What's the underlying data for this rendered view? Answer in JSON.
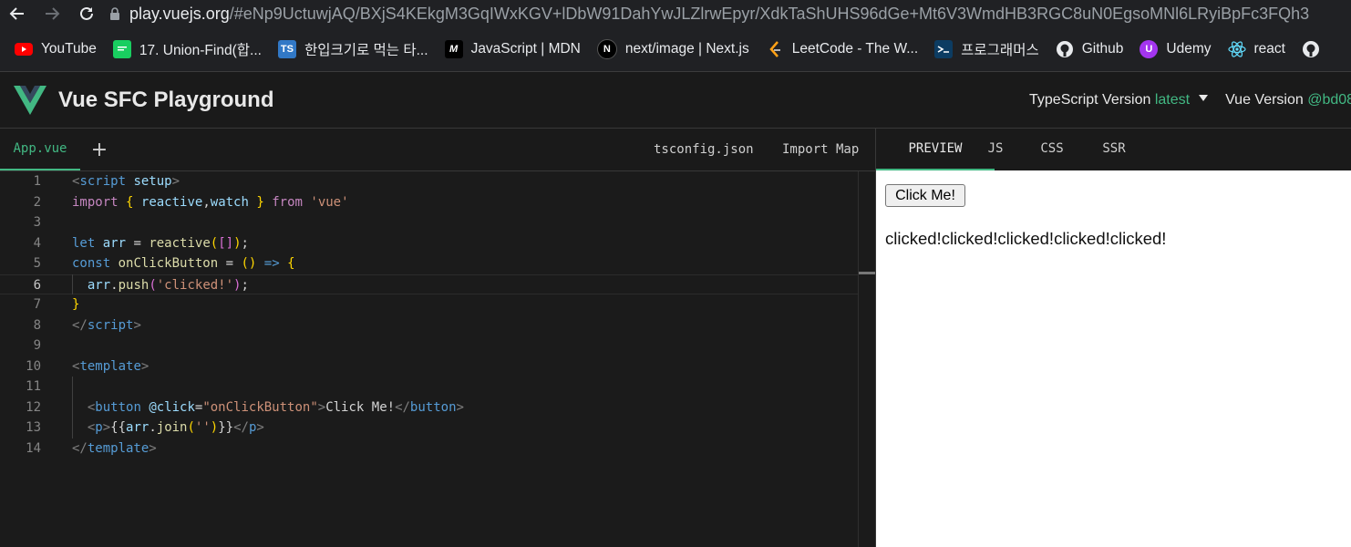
{
  "browser": {
    "url_domain": "play.vuejs.org",
    "url_rest": "/#eNp9UctuwjAQ/BXjS4KEkgM3GqIWxKGV+lDbW91DahYwJLZlrwEpyr/XdkTaShUHS96dGe+Mt6V3WmdHB3RGC8uN0EgsoMNl6LRyiBpFc3FQh3",
    "bookmarks": [
      {
        "label": "YouTube",
        "icon": "youtube-icon"
      },
      {
        "label": "17. Union-Find(합...",
        "icon": "chat-icon"
      },
      {
        "label": "한입크기로 먹는 타...",
        "icon": "typescript-icon"
      },
      {
        "label": "JavaScript | MDN",
        "icon": "mdn-icon"
      },
      {
        "label": "next/image | Next.js",
        "icon": "nextjs-icon"
      },
      {
        "label": "LeetCode - The W...",
        "icon": "leetcode-icon"
      },
      {
        "label": "프로그래머스",
        "icon": "programmers-icon"
      },
      {
        "label": "Github",
        "icon": "github-icon"
      },
      {
        "label": "Udemy",
        "icon": "udemy-icon"
      },
      {
        "label": "react",
        "icon": "react-icon"
      }
    ]
  },
  "header": {
    "title": "Vue SFC Playground",
    "ts_label": "TypeScript Version ",
    "ts_value": "latest",
    "vue_label": "Vue Version ",
    "vue_value": "@bd08"
  },
  "editor": {
    "tab": "App.vue",
    "add_label": "+",
    "tsconfig_label": "tsconfig.json",
    "importmap_label": "Import Map",
    "active_line": 6,
    "lines": [
      {
        "n": "1",
        "t": [
          [
            "tag",
            "<"
          ],
          [
            "tn",
            "script"
          ],
          [
            "op",
            " "
          ],
          [
            "attr",
            "setup"
          ],
          [
            "tag",
            ">"
          ]
        ]
      },
      {
        "n": "2",
        "t": [
          [
            "kw",
            "import"
          ],
          [
            "op",
            " "
          ],
          [
            "brk",
            "{"
          ],
          [
            "op",
            " "
          ],
          [
            "var",
            "reactive"
          ],
          [
            "op",
            ","
          ],
          [
            "var",
            "watch"
          ],
          [
            "op",
            " "
          ],
          [
            "brk",
            "}"
          ],
          [
            "op",
            " "
          ],
          [
            "kw",
            "from"
          ],
          [
            "op",
            " "
          ],
          [
            "str",
            "'vue'"
          ]
        ]
      },
      {
        "n": "3",
        "t": []
      },
      {
        "n": "4",
        "t": [
          [
            "let",
            "let"
          ],
          [
            "op",
            " "
          ],
          [
            "var",
            "arr"
          ],
          [
            "op",
            " = "
          ],
          [
            "fn",
            "reactive"
          ],
          [
            "brk",
            "("
          ],
          [
            "brk2",
            "[]"
          ],
          [
            "brk",
            ")"
          ],
          [
            "op",
            ";"
          ]
        ]
      },
      {
        "n": "5",
        "t": [
          [
            "let",
            "const"
          ],
          [
            "op",
            " "
          ],
          [
            "fn",
            "onClickButton"
          ],
          [
            "op",
            " = "
          ],
          [
            "brk",
            "()"
          ],
          [
            "op",
            " "
          ],
          [
            "arrow",
            "=>"
          ],
          [
            "op",
            " "
          ],
          [
            "brk",
            "{"
          ]
        ]
      },
      {
        "n": "6",
        "t": [
          [
            "op",
            "  "
          ],
          [
            "var",
            "arr"
          ],
          [
            "op",
            "."
          ],
          [
            "fn",
            "push"
          ],
          [
            "brk2",
            "("
          ],
          [
            "str",
            "'clicked!'"
          ],
          [
            "brk2",
            ")"
          ],
          [
            "op",
            ";"
          ]
        ]
      },
      {
        "n": "7",
        "t": [
          [
            "brk",
            "}"
          ]
        ]
      },
      {
        "n": "8",
        "t": [
          [
            "tag",
            "</"
          ],
          [
            "tn",
            "script"
          ],
          [
            "tag",
            ">"
          ]
        ]
      },
      {
        "n": "9",
        "t": []
      },
      {
        "n": "10",
        "t": [
          [
            "tag",
            "<"
          ],
          [
            "tn",
            "template"
          ],
          [
            "tag",
            ">"
          ]
        ]
      },
      {
        "n": "11",
        "t": []
      },
      {
        "n": "12",
        "t": [
          [
            "op",
            "  "
          ],
          [
            "tag",
            "<"
          ],
          [
            "tn",
            "button"
          ],
          [
            "op",
            " "
          ],
          [
            "attr",
            "@click"
          ],
          [
            "op",
            "="
          ],
          [
            "str",
            "\"onClickButton\""
          ],
          [
            "tag",
            ">"
          ],
          [
            "op",
            "Click Me!"
          ],
          [
            "tag",
            "</"
          ],
          [
            "tn",
            "button"
          ],
          [
            "tag",
            ">"
          ]
        ]
      },
      {
        "n": "13",
        "t": [
          [
            "op",
            "  "
          ],
          [
            "tag",
            "<"
          ],
          [
            "tn",
            "p"
          ],
          [
            "tag",
            ">"
          ],
          [
            "op",
            "{{"
          ],
          [
            "var",
            "arr"
          ],
          [
            "op",
            "."
          ],
          [
            "fn",
            "join"
          ],
          [
            "brk",
            "("
          ],
          [
            "str",
            "''"
          ],
          [
            "brk",
            ")"
          ],
          [
            "op",
            "}}"
          ],
          [
            "tag",
            "</"
          ],
          [
            "tn",
            "p"
          ],
          [
            "tag",
            ">"
          ]
        ]
      },
      {
        "n": "14",
        "t": [
          [
            "tag",
            "</"
          ],
          [
            "tn",
            "template"
          ],
          [
            "tag",
            ">"
          ]
        ]
      }
    ]
  },
  "output": {
    "tabs": [
      "PREVIEW",
      "JS",
      "CSS",
      "SSR"
    ],
    "active_tab": "PREVIEW",
    "button_label": "Click Me!",
    "text": "clicked!clicked!clicked!clicked!clicked!"
  },
  "colors": {
    "accent": "#42b883",
    "chrome_bg": "#202124",
    "app_bg": "#1a1a1a"
  }
}
